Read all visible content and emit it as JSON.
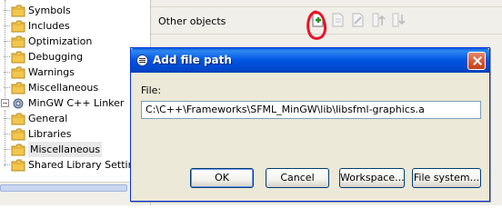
{
  "tree": {
    "items": [
      {
        "label": "Symbols"
      },
      {
        "label": "Includes"
      },
      {
        "label": "Optimization"
      },
      {
        "label": "Debugging"
      },
      {
        "label": "Warnings"
      },
      {
        "label": "Miscellaneous"
      },
      {
        "label": "MinGW C++ Linker"
      },
      {
        "label": "General"
      },
      {
        "label": "Libraries"
      },
      {
        "label": "Miscellaneous"
      },
      {
        "label": "Shared Library Settings"
      }
    ]
  },
  "right_panel": {
    "row_label": "Other objects",
    "icons": [
      "add-file-icon",
      "add-workspace-icon",
      "edit-icon",
      "move-up-icon",
      "move-down-icon"
    ]
  },
  "dialog": {
    "title": "Add file path",
    "file_label": "File:",
    "file_value": "C:\\C++\\Frameworks\\SFML_MinGW\\lib\\libsfml-graphics.a",
    "buttons": {
      "ok": "OK",
      "cancel": "Cancel",
      "workspace": "Workspace...",
      "file_system": "File system..."
    }
  },
  "colors": {
    "titlebar": "#0054e3",
    "dialog_bg": "#ece9d8",
    "annotation": "#e8142a"
  }
}
